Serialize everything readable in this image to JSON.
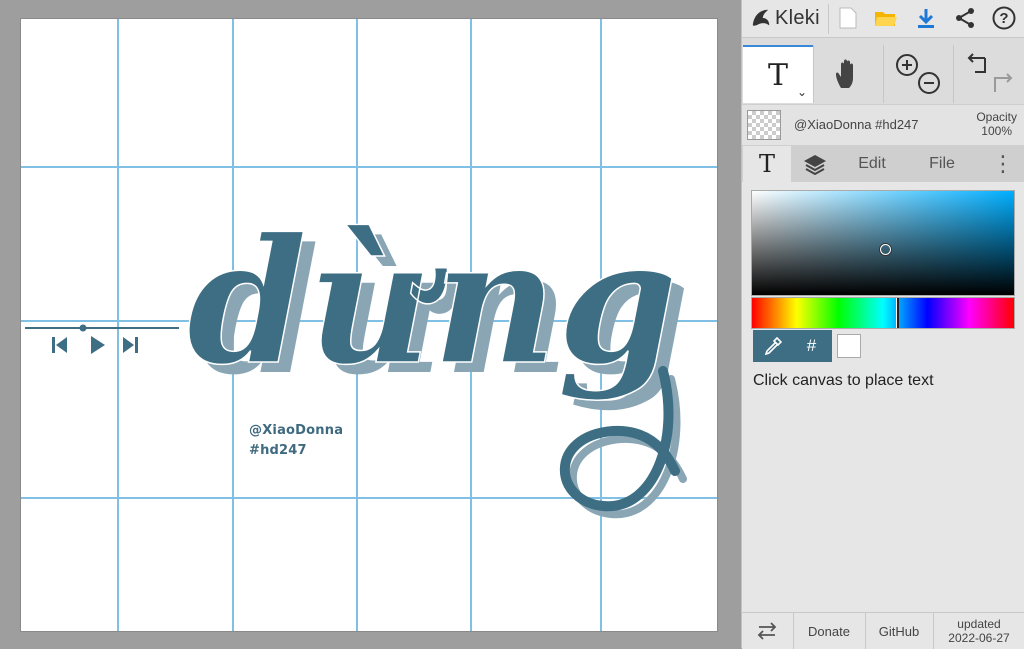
{
  "app": {
    "name": "Kleki"
  },
  "toolbar": {
    "icons": [
      "new-file-icon",
      "open-folder-icon",
      "download-icon",
      "share-icon",
      "help-icon"
    ],
    "tools": [
      "text-tool",
      "hand-tool",
      "zoom-tool",
      "undo-redo"
    ],
    "text_tool_glyph": "T",
    "text_tool_dropdown": "⌄"
  },
  "layer": {
    "name": "@XiaoDonna #hd247",
    "opacity_label": "Opacity",
    "opacity_value": "100%"
  },
  "tabs": {
    "text_glyph": "T",
    "edit": "Edit",
    "file": "File",
    "more": "⋮"
  },
  "color": {
    "primary": "#3d6e84",
    "secondary": "#ffffff",
    "hex_button": "#"
  },
  "hint": "Click canvas to place text",
  "canvas": {
    "word": "dừng",
    "credit_line1": "@XiaoDonna",
    "credit_line2": "#hd247",
    "text_color": "#3d6e84",
    "grid_color": "#7fc0e4"
  },
  "footer": {
    "donate": "Donate",
    "github": "GitHub",
    "updated_label": "updated",
    "updated_date": "2022-06-27"
  }
}
